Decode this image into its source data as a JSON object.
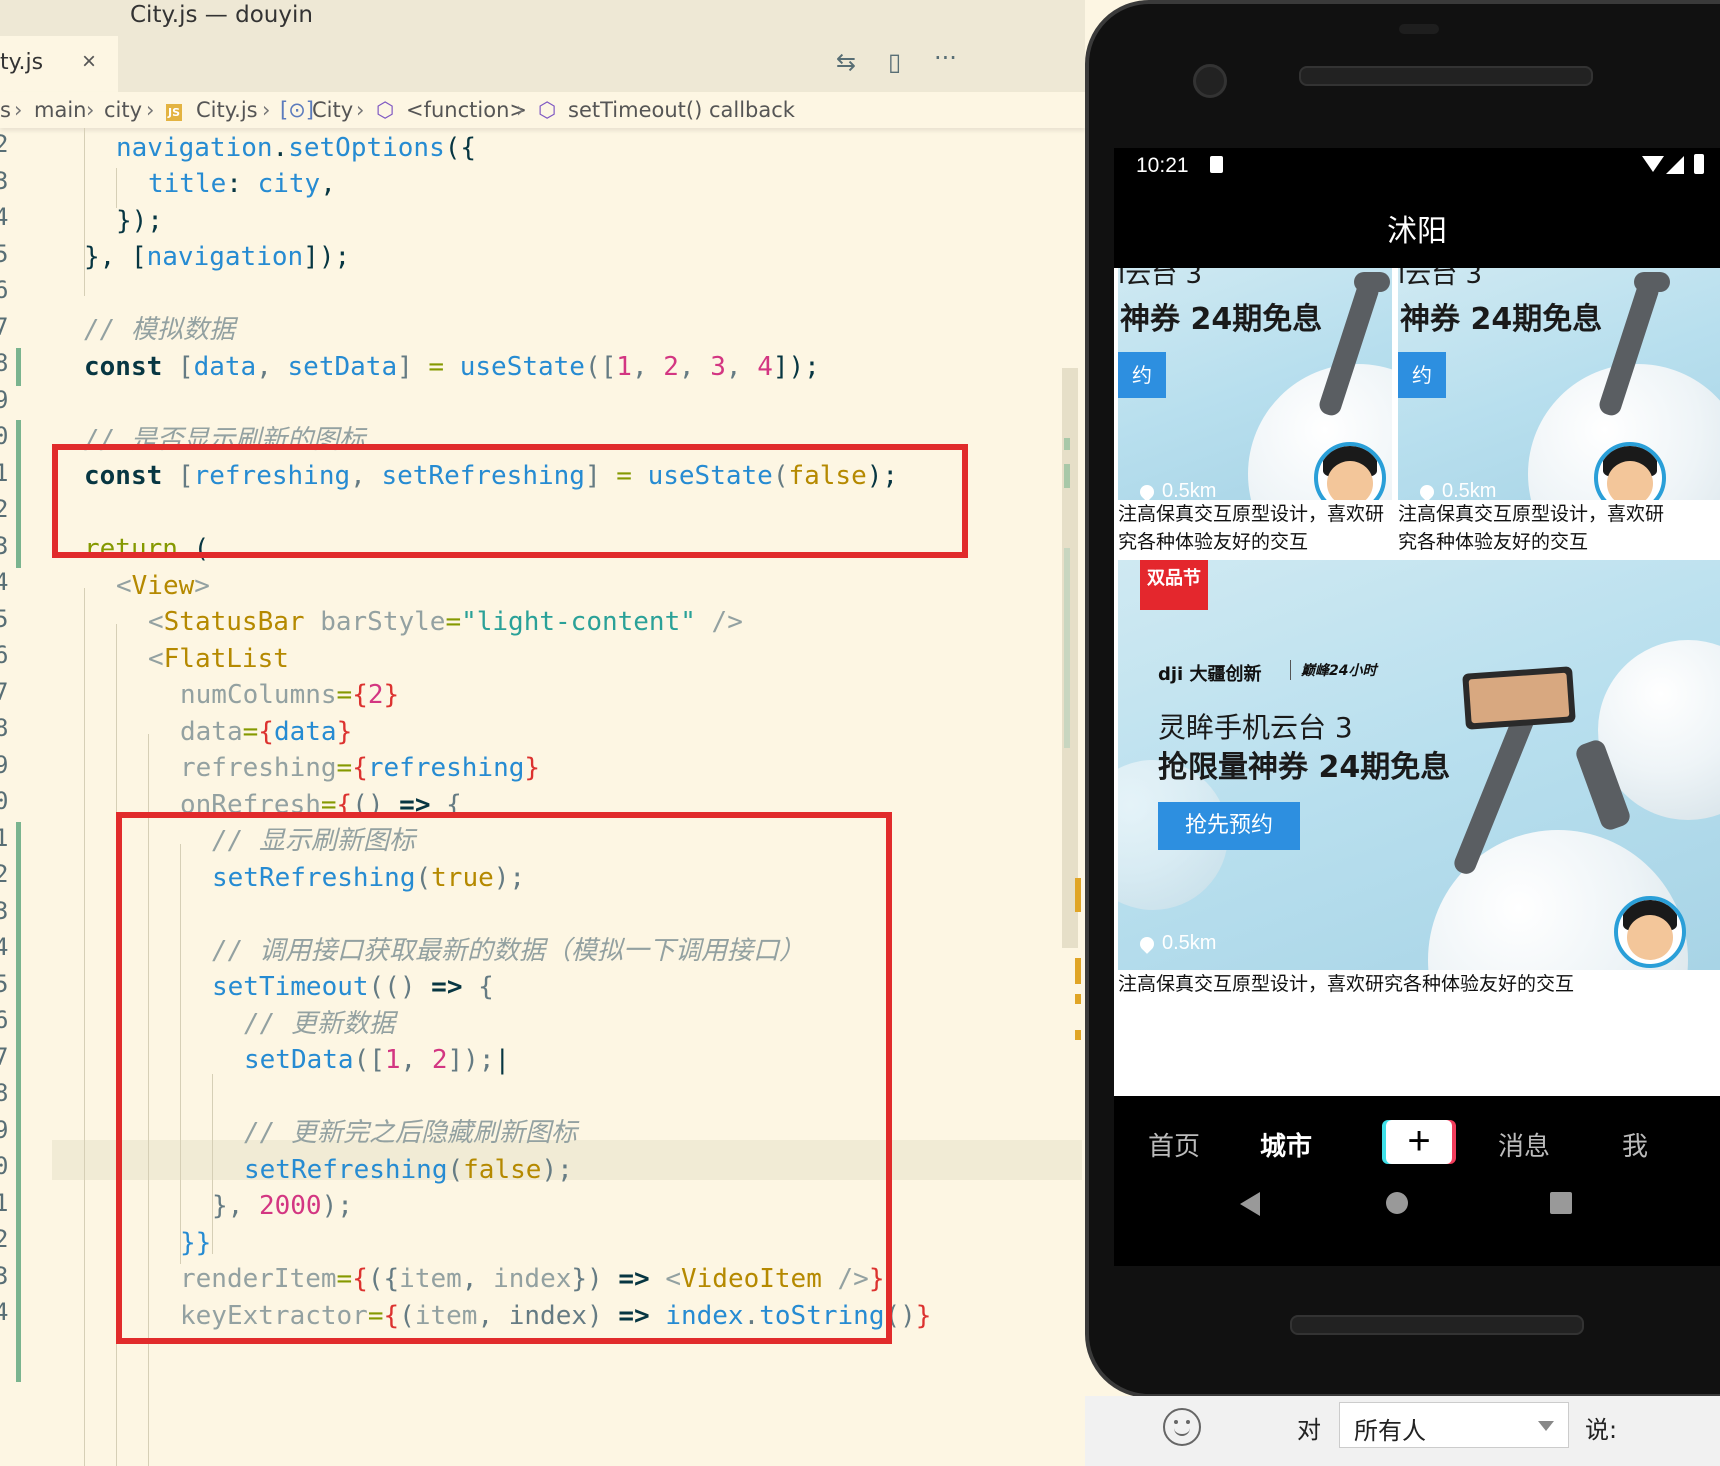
{
  "window": {
    "title": "City.js — douyin"
  },
  "tab": {
    "label": "ty.js",
    "close": "×"
  },
  "toolbar": {
    "compare_icon": "⇆",
    "split_icon": "▯",
    "more_icon": "···"
  },
  "breadcrumb": [
    "s",
    "main",
    "city",
    "City.js",
    "City",
    "<function>",
    "setTimeout() callback"
  ],
  "line_numbers": [
    "2",
    "3",
    "4",
    "5",
    "6",
    "7",
    "8",
    "9",
    "0",
    "1",
    "2",
    "3",
    "4",
    "5",
    "6",
    "7",
    "8",
    "9",
    "0",
    "1",
    "2",
    "3",
    "4",
    "5",
    "6",
    "7",
    "8",
    "9",
    "0",
    "1",
    "2",
    "3",
    "4"
  ],
  "code": {
    "l1": [
      "navigation",
      ".",
      "setOptions",
      "({"
    ],
    "l2": [
      "title",
      ": ",
      "city",
      ","
    ],
    "l3": "});",
    "l4": [
      "}, [",
      "navigation",
      "]);"
    ],
    "l6": "// 模拟数据",
    "l7": [
      "const",
      " [",
      "data",
      ", ",
      "setData",
      "] ",
      "=",
      " ",
      "useState",
      "([",
      "1",
      ", ",
      "2",
      ", ",
      "3",
      ", ",
      "4",
      "]);"
    ],
    "l9": "// 是否显示刷新的图标",
    "l10": [
      "const",
      " [",
      "refreshing",
      ", ",
      "setRefreshing",
      "] ",
      "=",
      " ",
      "useState",
      "(",
      "false",
      ");"
    ],
    "l12": [
      "return",
      " ("
    ],
    "l13": [
      "<",
      "View",
      ">"
    ],
    "l14": [
      "<",
      "StatusBar",
      " ",
      "barStyle",
      "=",
      "\"light-content\"",
      " />"
    ],
    "l15": [
      "<",
      "FlatList"
    ],
    "l16": [
      "numColumns",
      "=",
      "{",
      "2",
      "}"
    ],
    "l17": [
      "data",
      "=",
      "{",
      "data",
      "}"
    ],
    "l18": [
      "refreshing",
      "=",
      "{",
      "refreshing",
      "}"
    ],
    "l19": [
      "onRefresh",
      "=",
      "{",
      "() ",
      "=>",
      " {"
    ],
    "l20": "// 显示刷新图标",
    "l21": [
      "setRefreshing",
      "(",
      "true",
      ");"
    ],
    "l23": "// 调用接口获取最新的数据（模拟一下调用接口）",
    "l24": [
      "setTimeout",
      "(() ",
      "=>",
      " {"
    ],
    "l25": "// 更新数据",
    "l26": [
      "setData",
      "([",
      "1",
      ", ",
      "2",
      "]);"
    ],
    "l28": "// 更新完之后隐藏刷新图标",
    "l29": [
      "setRefreshing",
      "(",
      "false",
      ");"
    ],
    "l30": [
      "}",
      ", ",
      "2000",
      ");"
    ],
    "l31": "}}",
    "l32": [
      "renderItem",
      "=",
      "{",
      "({",
      "item",
      ", ",
      "index",
      "}) ",
      "=>",
      " <",
      "VideoItem",
      " />",
      "}"
    ],
    "l33": [
      "keyExtractor",
      "=",
      "{",
      "(",
      "item",
      ", ",
      "index",
      ") ",
      "=>",
      " ",
      "index",
      ".",
      "toString",
      "()",
      "}"
    ]
  },
  "phone": {
    "time": "10:21",
    "header_title": "沭阳",
    "card_small": {
      "title_top": "l云台 3",
      "title": "神券 24期免息",
      "button": "约",
      "distance": "0.5km",
      "desc_line1": "注高保真交互原型设计，喜欢研",
      "desc_line2": "究各种体验友好的交互"
    },
    "card_large": {
      "badge": "双品节",
      "brand": "dji 大疆创新",
      "brand2": "巅峰24小时",
      "title1": "灵眸手机云台 3",
      "title2": "抢限量神券 24期免息",
      "button": "抢先预约",
      "distance": "0.5km",
      "desc": "注高保真交互原型设计，喜欢研究各种体验友好的交互"
    },
    "tabs": [
      "首页",
      "城市",
      "+",
      "消息",
      "我"
    ]
  },
  "chat": {
    "to_label": "对",
    "recipient": "所有人",
    "say_label": "说:"
  },
  "colors": {
    "highlight_box": "#e12b2b",
    "editor_bg": "#fdf6e3",
    "accent_blue": "#268bd2"
  }
}
